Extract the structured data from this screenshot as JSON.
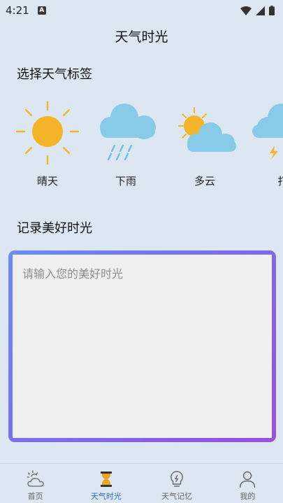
{
  "status_bar": {
    "time": "4:21",
    "badge": "A"
  },
  "header": {
    "title": "天气时光"
  },
  "weather_section": {
    "title": "选择天气标签",
    "tags": [
      {
        "label": "晴天",
        "icon": "sun-icon"
      },
      {
        "label": "下雨",
        "icon": "rain-cloud-icon"
      },
      {
        "label": "多云",
        "icon": "partly-cloudy-icon"
      },
      {
        "label": "打",
        "icon": "thunder-cloud-icon"
      }
    ]
  },
  "memory_section": {
    "title": "记录美好时光",
    "placeholder": "请输入您的美好时光",
    "value": ""
  },
  "bottom_nav": {
    "items": [
      {
        "label": "首页",
        "icon": "weather-home-icon"
      },
      {
        "label": "天气时光",
        "icon": "hourglass-icon",
        "active": true
      },
      {
        "label": "天气记忆",
        "icon": "lightbulb-icon"
      },
      {
        "label": "我的",
        "icon": "user-icon"
      }
    ]
  },
  "colors": {
    "background": "#dde7f1",
    "sun": "#f5b52a",
    "cloud": "#87cbe8",
    "rain": "#6fbfe0",
    "frame_gradient_start": "#6b8df0",
    "frame_gradient_end": "#9a4fe0",
    "accent": "#2f6dd0"
  }
}
